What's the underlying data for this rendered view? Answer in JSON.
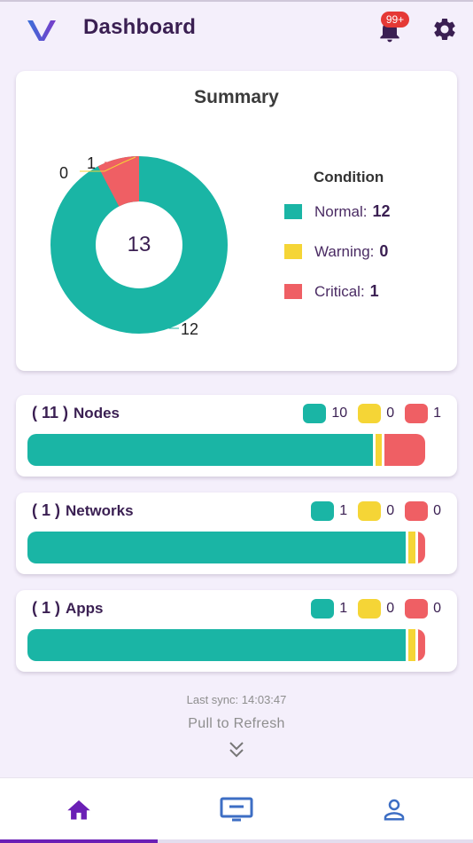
{
  "header": {
    "title": "Dashboard",
    "notification_badge": "99+",
    "icons": [
      "app-logo",
      "bell-icon",
      "gear-icon"
    ]
  },
  "summary": {
    "title": "Summary",
    "total": "13",
    "legend_title": "Condition",
    "conditions": [
      {
        "label": "Normal:",
        "count": "12",
        "color": "#1ab5a5"
      },
      {
        "label": "Warning:",
        "count": "0",
        "color": "#f5d536"
      },
      {
        "label": "Critical:",
        "count": "1",
        "color": "#ef5f64"
      }
    ],
    "slice_labels": {
      "normal": "12",
      "warning": "0",
      "critical": "1"
    }
  },
  "stats": [
    {
      "count": "( 11 )",
      "name": "Nodes",
      "normal": "10",
      "warning": "0",
      "critical": "1",
      "fractions": [
        0.868,
        0.022,
        0.11
      ]
    },
    {
      "count": "( 1 )",
      "name": "Networks",
      "normal": "1",
      "warning": "0",
      "critical": "0",
      "fractions": [
        0.952,
        0.024,
        0.024
      ]
    },
    {
      "count": "( 1 )",
      "name": "Apps",
      "normal": "1",
      "warning": "0",
      "critical": "0",
      "fractions": [
        0.952,
        0.024,
        0.024
      ]
    }
  ],
  "colors": {
    "normal": "#1ab5a5",
    "warning": "#f5d536",
    "critical": "#ef5f64",
    "accent": "#6a1fb5"
  },
  "footer": {
    "last_sync": "Last sync: 14:03:47",
    "refresh": "Pull to Refresh"
  },
  "nav": [
    {
      "icon": "home-icon",
      "active": true
    },
    {
      "icon": "monitor-icon",
      "active": false
    },
    {
      "icon": "person-icon",
      "active": false
    }
  ]
}
